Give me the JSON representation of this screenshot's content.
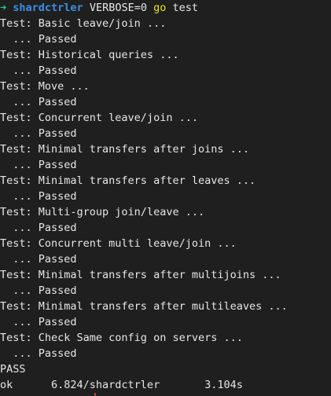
{
  "prompt": {
    "arrow": "➜",
    "directory": "shardctrler",
    "env": "VERBOSE=0",
    "command": "go",
    "args": "test"
  },
  "output_lines": [
    "Test: Basic leave/join ...",
    "  ... Passed",
    "Test: Historical queries ...",
    "  ... Passed",
    "Test: Move ...",
    "  ... Passed",
    "Test: Concurrent leave/join ...",
    "  ... Passed",
    "Test: Minimal transfers after joins ...",
    "  ... Passed",
    "Test: Minimal transfers after leaves ...",
    "  ... Passed",
    "Test: Multi-group join/leave ...",
    "  ... Passed",
    "Test: Concurrent multi leave/join ...",
    "  ... Passed",
    "Test: Minimal transfers after multijoins ...",
    "  ... Passed",
    "Test: Minimal transfers after multileaves ...",
    "  ... Passed",
    "Test: Check Same config on servers ...",
    "  ... Passed",
    "PASS",
    "ok      6.824/shardctrler       3.104s"
  ],
  "colors": {
    "background": "#1f1f1f",
    "text": "#e6e6e6",
    "arrow": "#23d18b",
    "directory": "#3b8eea",
    "command": "#e5e510"
  }
}
